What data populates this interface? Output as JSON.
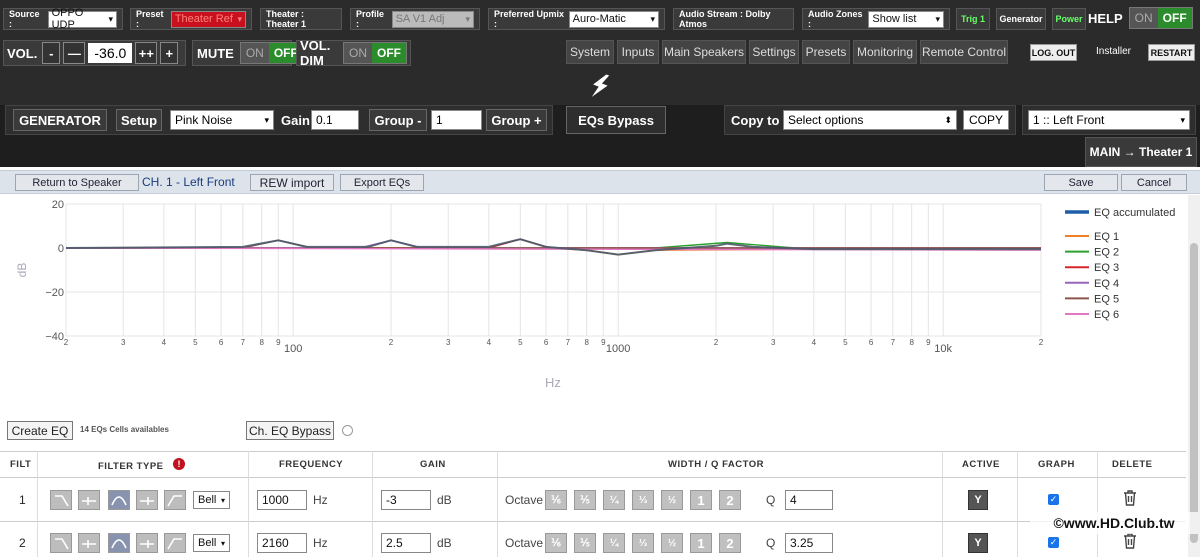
{
  "top": {
    "source": {
      "label": "Source :",
      "value": "OPPO UDP"
    },
    "preset": {
      "label": "Preset :",
      "value": "Theater Ref"
    },
    "theater": {
      "label": "Theater : Theater 1"
    },
    "profile": {
      "label": "Profile :",
      "value": "SA V1 Adj"
    },
    "upmix": {
      "label": "Preferred Upmix :",
      "value": "Auro-Matic"
    },
    "audio_stream": {
      "label": "Audio Stream : Dolby Atmos"
    },
    "zones": {
      "label": "Audio Zones :",
      "value": "Show list"
    },
    "trig": "Trig 1",
    "generator": "Generator",
    "power": "Power",
    "help": {
      "label": "HELP",
      "on": "ON",
      "off": "OFF"
    }
  },
  "volume": {
    "label": "VOL.",
    "minus": "-",
    "minus2": "—",
    "value": "-36.0",
    "plus2": "++",
    "plus": "+"
  },
  "mute": {
    "label": "MUTE",
    "on": "ON",
    "off": "OFF"
  },
  "voldim": {
    "label": "VOL. DIM",
    "on": "ON",
    "off": "OFF"
  },
  "nav": {
    "tabs": [
      "System",
      "Inputs",
      "Main Speakers",
      "Settings",
      "Presets",
      "Monitoring",
      "Remote Control"
    ]
  },
  "account": {
    "logout": "LOG. OUT",
    "user": "Installer",
    "restart": "RESTART"
  },
  "logo_icon": "lightning-icon",
  "gen": {
    "generator": "GENERATOR",
    "setup": "Setup",
    "noise": "Pink Noise",
    "gain_label": "Gain",
    "gain_value": "0.1",
    "group_minus": "Group -",
    "group_value": "1",
    "group_plus": "Group +",
    "eq_bypass": "EQs Bypass",
    "copy_label": "Copy to :",
    "copy_placeholder": "Select options",
    "copy_btn": "COPY",
    "channel": "1 :: Left Front",
    "breadcrumb": "MAIN → Theater 1"
  },
  "subbar": {
    "return": "Return to Speaker",
    "channel_title": "CH. 1 - Left Front",
    "rew": "REW import",
    "export": "Export EQs",
    "save": "Save",
    "cancel": "Cancel"
  },
  "chart_data": {
    "type": "line",
    "ylabel": "dB",
    "xlabel": "Hz",
    "ylim": [
      -40,
      20
    ],
    "yticks": [
      "20",
      "0",
      "−20",
      "−40"
    ],
    "xscale": "log",
    "xlim": [
      20,
      20000
    ],
    "xtick_labels": [
      "2",
      "3",
      "4",
      "5",
      "6",
      "7",
      "8",
      "9",
      "100",
      "2",
      "3",
      "4",
      "5",
      "6",
      "7",
      "8",
      "9",
      "1000",
      "2",
      "3",
      "4",
      "5",
      "6",
      "7",
      "8",
      "9",
      "10k",
      "2"
    ],
    "legend_position": "right",
    "series": [
      {
        "name": "EQ accumulated",
        "color": "#1f5fa8",
        "x": [
          20,
          70,
          90,
          110,
          170,
          200,
          240,
          400,
          500,
          600,
          800,
          1000,
          1300,
          2000,
          2160,
          2600,
          4000,
          20000
        ],
        "y": [
          0,
          0.5,
          3.5,
          0.5,
          0.5,
          3.5,
          0.5,
          0.5,
          4,
          0.5,
          -1,
          -3,
          -1,
          1,
          2,
          0.5,
          -0.5,
          -0.5
        ]
      },
      {
        "name": "EQ 1",
        "color": "#f07f2a",
        "x": [
          20,
          600,
          800,
          1000,
          1300,
          20000
        ],
        "y": [
          0,
          0,
          -1,
          -3,
          -1,
          0
        ]
      },
      {
        "name": "EQ 2",
        "color": "#2ca02c",
        "x": [
          20,
          1300,
          2160,
          3500,
          20000
        ],
        "y": [
          0,
          0,
          2.5,
          0,
          0
        ]
      },
      {
        "name": "EQ 3",
        "color": "#d62728",
        "x": [
          20,
          400,
          500,
          620,
          20000
        ],
        "y": [
          0,
          0,
          4,
          0,
          0
        ]
      },
      {
        "name": "EQ 4",
        "color": "#9467bd",
        "x": [
          20,
          160,
          200,
          250,
          20000
        ],
        "y": [
          0,
          0,
          3.5,
          0,
          0
        ]
      },
      {
        "name": "EQ 5",
        "color": "#8c564b",
        "x": [
          20,
          70,
          90,
          115,
          20000
        ],
        "y": [
          0,
          0,
          3.5,
          0,
          0
        ]
      },
      {
        "name": "EQ 6",
        "color": "#e377c2",
        "x": [
          20,
          20000
        ],
        "y": [
          0,
          -1
        ]
      }
    ]
  },
  "eq_controls": {
    "create": "Create EQ",
    "cells": "14 EQs Cells availables",
    "ch_bypass": "Ch. EQ Bypass"
  },
  "table": {
    "headers": {
      "filt": "FILT",
      "type": "FILTER TYPE",
      "freq": "FREQUENCY",
      "gain": "GAIN",
      "width": "WIDTH / Q FACTOR",
      "active": "ACTIVE",
      "graph": "GRAPH",
      "delete": "DELETE"
    },
    "octave_options": [
      "⅙",
      "⅕",
      "¼",
      "⅓",
      "½",
      "1",
      "2"
    ],
    "rows": [
      {
        "num": "1",
        "type": "Bell",
        "freq": "1000",
        "unit_hz": "Hz",
        "gain": "-3",
        "unit_db": "dB",
        "octave": "Octave",
        "q_label": "Q",
        "q": "4",
        "active": "Y"
      },
      {
        "num": "2",
        "type": "Bell",
        "freq": "2160",
        "unit_hz": "Hz",
        "gain": "2.5",
        "unit_db": "dB",
        "octave": "Octave",
        "q_label": "Q",
        "q": "3.25",
        "active": "Y"
      }
    ]
  },
  "watermark": "©www.HD.Club.tw"
}
